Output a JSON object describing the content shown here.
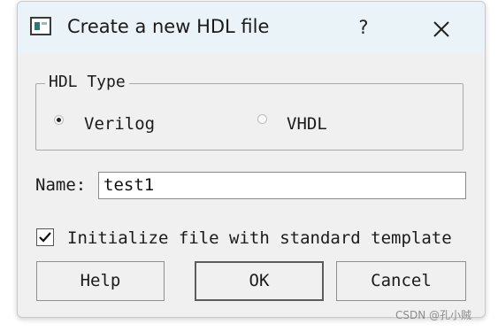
{
  "window": {
    "title": "Create a new HDL file",
    "help_glyph": "?",
    "close_icon": "close-icon"
  },
  "hdl_type": {
    "group_label": "HDL Type",
    "options": [
      {
        "label": "Verilog",
        "selected": true
      },
      {
        "label": "VHDL",
        "selected": false
      }
    ]
  },
  "name_field": {
    "label": "Name:",
    "value": "test1"
  },
  "template_option": {
    "label": "Initialize file with standard template",
    "checked": true
  },
  "buttons": {
    "help": "Help",
    "ok": "OK",
    "cancel": "Cancel"
  },
  "watermark": "CSDN @孔小贼",
  "colors": {
    "titlebar_bg": "#eaf4f8",
    "dialog_bg": "#f0f0f0"
  }
}
